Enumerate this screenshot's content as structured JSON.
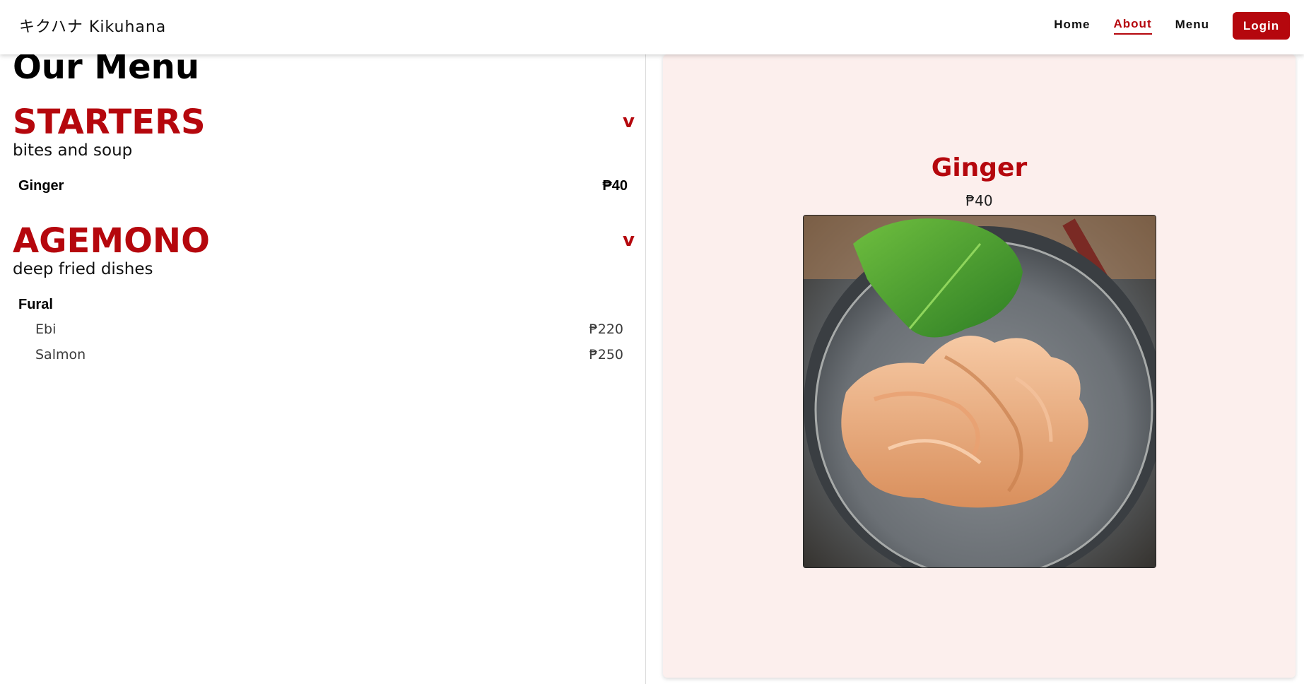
{
  "header": {
    "brand": "キクハナ Kikuhana",
    "nav": [
      "Home",
      "About",
      "Menu"
    ],
    "active_nav": "About",
    "login_label": "Login"
  },
  "menu": {
    "title": "Our Menu",
    "categories": [
      {
        "name": "STARTERS",
        "description": "bites and soup",
        "toggle": "v",
        "items": [
          {
            "name": "Ginger",
            "price": "₱40"
          }
        ]
      },
      {
        "name": "AGEMONO",
        "description": "deep fried dishes",
        "toggle": "v",
        "group": "Fural",
        "items": [
          {
            "name": "Ebi",
            "price": "₱220"
          },
          {
            "name": "Salmon",
            "price": "₱250"
          }
        ]
      }
    ]
  },
  "detail": {
    "name": "Ginger",
    "price": "₱40",
    "image": "pickled-ginger-in-stone-bowl-with-shiso-leaf"
  },
  "colors": {
    "accent": "#b5070d",
    "panel_bg": "#fcefed"
  }
}
